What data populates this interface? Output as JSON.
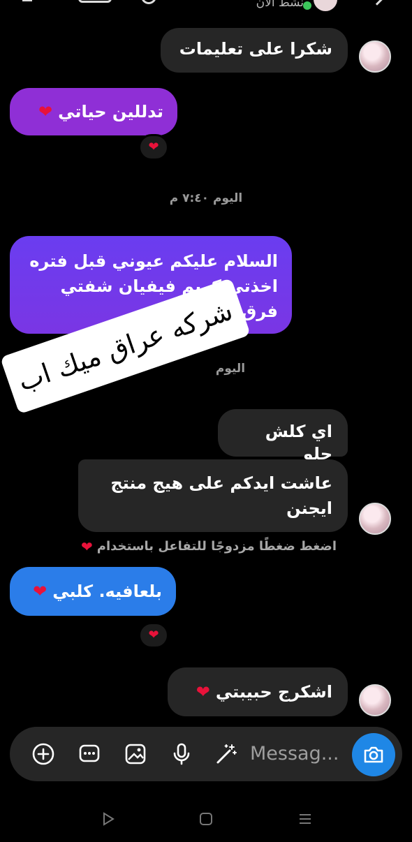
{
  "header": {
    "status_text": "نشط الآن"
  },
  "messages": {
    "m1": "شكرا على تعليمات",
    "m2": "تدللين حياتي",
    "time1": "اليوم ٧:٤٠ م",
    "m3": "السلام عليكم عيوني قبل فتره اخذتي كريم فيفيان شفتي فرق عليه؟",
    "time2": "اليوم",
    "m4": "اي كلش حلو",
    "m5": "عاشت ايدكم على هيج منتج ايجنن",
    "hint": "اضغط ضغطًا مزدوجًا للتفاعل باستخدام",
    "m6": "بلعافيه. كلبي",
    "m7": "اشكرج حبيبتي"
  },
  "watermark": "شركه عراق ميك اب",
  "composer": {
    "placeholder": "Messag..."
  },
  "colors": {
    "purple_start": "#6a3df0",
    "purple_end": "#9a2ed6",
    "blue_bubble": "#2b7de9",
    "camera": "#1f87e6",
    "gray_bubble": "#262626",
    "heart": "#e8123a"
  },
  "icons": {
    "add": "plus-circle-icon",
    "sticker": "chat-sticker-icon",
    "gallery": "gallery-icon",
    "mic": "microphone-icon",
    "effects": "magic-wand-icon",
    "camera": "camera-icon",
    "reaction": "heart-icon"
  }
}
